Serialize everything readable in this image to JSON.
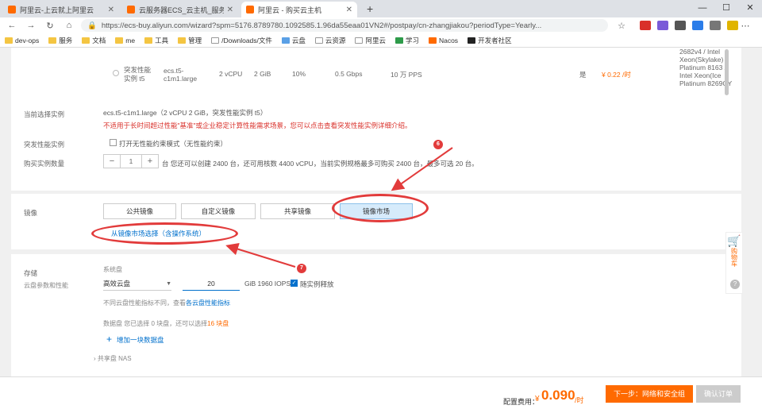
{
  "browser": {
    "tabs": [
      {
        "title": "阿里云-上云就上阿里云",
        "active": false
      },
      {
        "title": "云服务器ECS_云主机_服务器",
        "active": false
      },
      {
        "title": "阿里云 - 购买云主机",
        "active": true
      }
    ],
    "url": "https://ecs-buy.aliyun.com/wizard?spm=5176.8789780.1092585.1.96da55eaa01VN2#/postpay/cn-zhangjiakou?periodType=Yearly...",
    "bookmarks": [
      "dev-ops",
      "服务",
      "文档",
      "me",
      "工具",
      "管理",
      "/Downloads/文件",
      "云盘",
      "云资源",
      "阿里云",
      "学习",
      "Nacos",
      "开发者社区"
    ]
  },
  "instance_row": {
    "name_l1": "突发性能",
    "name_l2": "实例 t5",
    "type": "ecs.t5-c1m1.large",
    "vcpu": "2 vCPU",
    "mem": "2 GiB",
    "cpu_base": "10%",
    "net_bw": "0.5 Gbps",
    "pps": "10 万 PPS",
    "flag": "是",
    "price": "¥ 0.22 /时",
    "cpu_model_lines": [
      "2682v4 / Intel",
      "Xeon(Skylake)",
      "Platinum 8163 /",
      "Intel Xeon(Ice",
      "Platinum 8269CY"
    ]
  },
  "selected_spec": {
    "label": "当前选择实例",
    "value": "ecs.t5-c1m1.large（2 vCPU 2 GiB，突发性能实例 t5）",
    "warning": "不适用于长时间超过性能\"基准\"或企业稳定计算性能需求场景，您可以点击查看突发性能实例详细介绍。"
  },
  "burst": {
    "label": "突发性能实例",
    "checkbox_text": "打开无性能约束模式（无性能约束）"
  },
  "quantity": {
    "label": "购买实例数量",
    "value": "1",
    "note": "台  您还可以创建 2400 台，还可用核数 4400 vCPU，当前实例规格最多可购买 2400 台，最多可选 20 台。"
  },
  "image": {
    "label": "镜像",
    "tabs": [
      "公共镜像",
      "自定义镜像",
      "共享镜像",
      "镜像市场"
    ],
    "selected_index": 3,
    "market_link": "从镜像市场选择（含操作系统）"
  },
  "storage": {
    "label": "存储",
    "sublabel": "云盘参数和性能",
    "system_disk_label": "系统盘",
    "disk_type": "高效云盘",
    "disk_size": "20",
    "disk_unit": "GiB  1960 IOPS",
    "release_checkbox": "随实例释放",
    "hint_text": "不同云盘性能指标不同，查看",
    "hint_link": "各云盘性能指标",
    "data_disk_text": "数据盘  您已选择 0 块盘，还可以选择",
    "data_disk_count": "16 块盘",
    "add_disk": "增加一块数据盘",
    "shared_disk": "共享盘 NAS"
  },
  "annotations": [
    {
      "id": "6"
    },
    {
      "id": "7"
    }
  ],
  "footer": {
    "fee_label": "配置费用：",
    "currency": "¥",
    "price": "0.090",
    "unit": "/时",
    "confirm_button": "下一步：网络和安全组",
    "cancel_button": "确认订单"
  },
  "floating_sidebar": {
    "label": "购物车"
  },
  "colors": {
    "accent": "#ff6a00",
    "link": "#0070cc",
    "annotation": "#e23b3b",
    "selected_tab": "#d6ebfb"
  }
}
